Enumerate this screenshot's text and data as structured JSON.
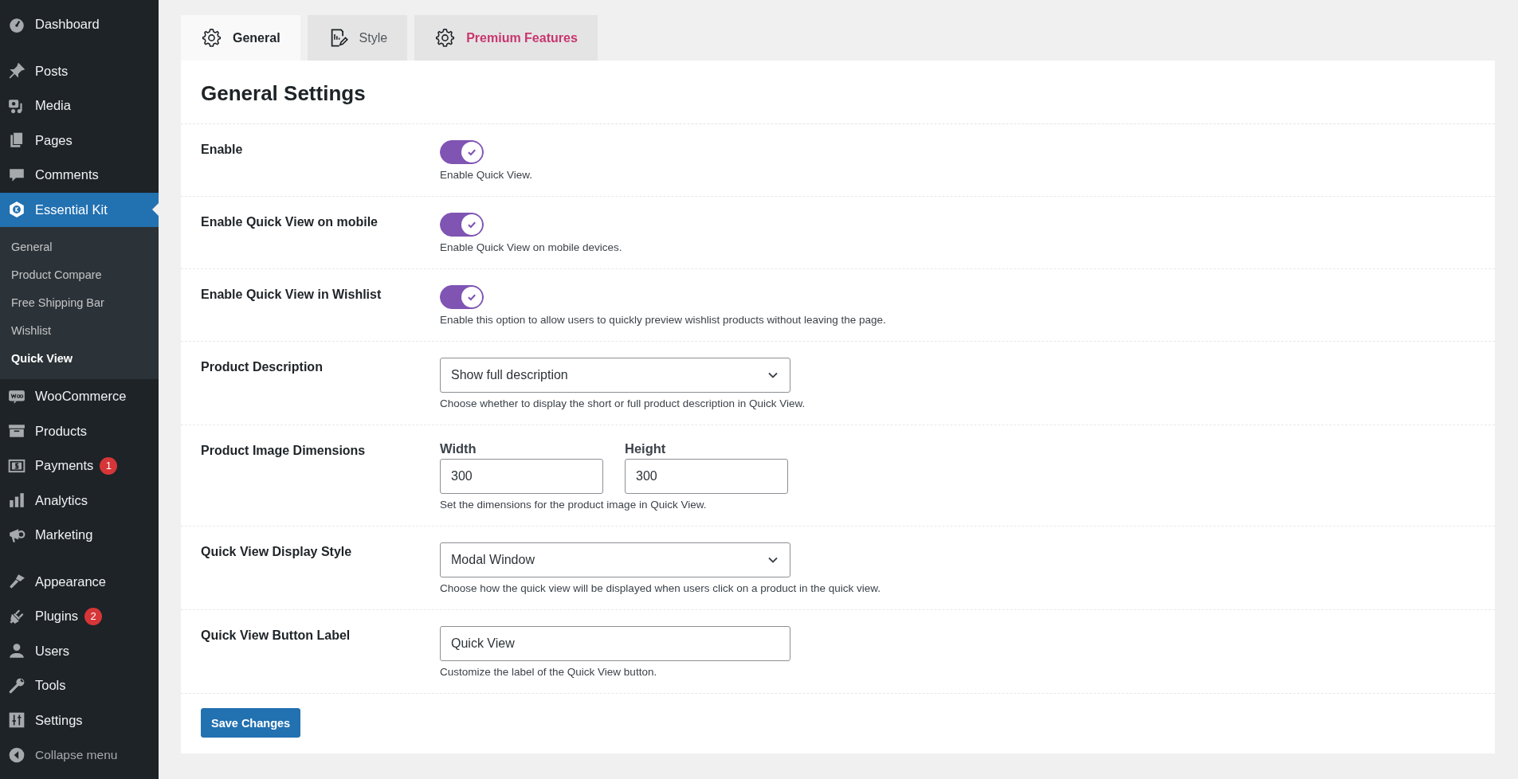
{
  "sidebar": {
    "items": [
      {
        "label": "Dashboard",
        "selected": false
      },
      {
        "label": "Posts",
        "selected": false
      },
      {
        "label": "Media",
        "selected": false
      },
      {
        "label": "Pages",
        "selected": false
      },
      {
        "label": "Comments",
        "selected": false
      },
      {
        "label": "Essential Kit",
        "selected": true,
        "children": [
          {
            "label": "General",
            "selected": false
          },
          {
            "label": "Product Compare",
            "selected": false
          },
          {
            "label": "Free Shipping Bar",
            "selected": false
          },
          {
            "label": "Wishlist",
            "selected": false
          },
          {
            "label": "Quick View",
            "selected": true
          }
        ]
      },
      {
        "label": "WooCommerce",
        "selected": false
      },
      {
        "label": "Products",
        "selected": false
      },
      {
        "label": "Payments",
        "selected": false,
        "badge": "1"
      },
      {
        "label": "Analytics",
        "selected": false
      },
      {
        "label": "Marketing",
        "selected": false
      },
      {
        "label": "Appearance",
        "selected": false
      },
      {
        "label": "Plugins",
        "selected": false,
        "badge": "2"
      },
      {
        "label": "Users",
        "selected": false
      },
      {
        "label": "Tools",
        "selected": false
      },
      {
        "label": "Settings",
        "selected": false
      }
    ],
    "collapse": "Collapse menu"
  },
  "tabs": [
    {
      "label": "General",
      "selected": true,
      "premium": false
    },
    {
      "label": "Style",
      "selected": false,
      "premium": false
    },
    {
      "label": "Premium Features",
      "selected": false,
      "premium": true
    }
  ],
  "panel": {
    "title": "General Settings",
    "rows": [
      {
        "kind": "toggle",
        "label": "Enable",
        "on": true,
        "description": "Enable Quick View."
      },
      {
        "kind": "toggle",
        "label": "Enable Quick View on mobile",
        "on": true,
        "description": "Enable Quick View on mobile devices."
      },
      {
        "kind": "toggle",
        "label": "Enable Quick View in Wishlist",
        "on": true,
        "description": "Enable this option to allow users to quickly preview wishlist products without leaving the page."
      },
      {
        "kind": "select",
        "label": "Product Description",
        "value": "Show full description",
        "description": "Choose whether to display the short or full product description in Quick View."
      },
      {
        "kind": "dimensions",
        "label": "Product Image Dimensions",
        "fields": [
          {
            "label": "Width",
            "value": "300"
          },
          {
            "label": "Height",
            "value": "300"
          }
        ],
        "description": "Set the dimensions for the product image in Quick View."
      },
      {
        "kind": "select",
        "label": "Quick View Display Style",
        "value": "Modal Window",
        "description": "Choose how the quick view will be displayed when users click on a product in the quick view."
      },
      {
        "kind": "text",
        "label": "Quick View Button Label",
        "value": "Quick View",
        "description": "Customize the label of the Quick View button."
      }
    ],
    "save": "Save Changes"
  }
}
